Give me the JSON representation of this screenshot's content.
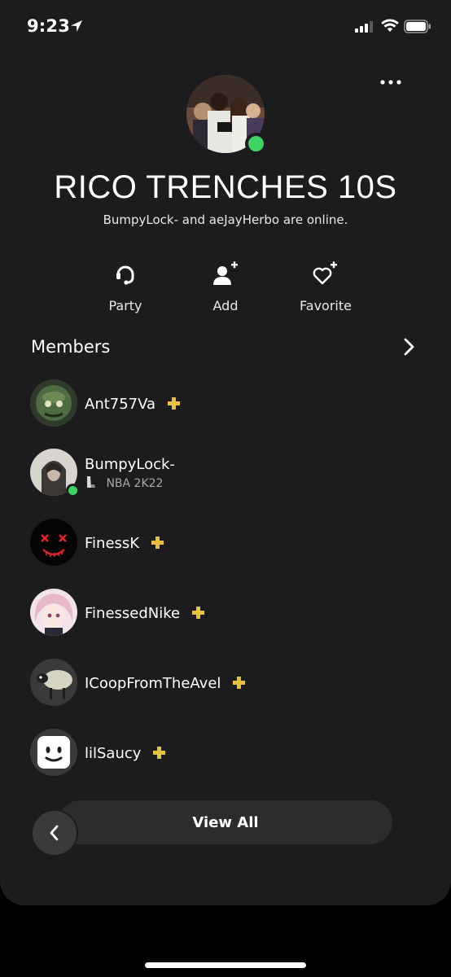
{
  "status_bar": {
    "time": "9:23"
  },
  "group": {
    "name": "RICO TRENCHES 10S",
    "online_summary": "BumpyLock- and aeJayHerbo are online."
  },
  "actions": [
    {
      "label": "Party",
      "icon": "headset-icon"
    },
    {
      "label": "Add",
      "icon": "add-user-icon"
    },
    {
      "label": "Favorite",
      "icon": "heart-plus-icon"
    }
  ],
  "members_section": {
    "title": "Members"
  },
  "members": [
    {
      "name": "Ant757Va",
      "plus": true,
      "online": false,
      "activity": ""
    },
    {
      "name": "BumpyLock-",
      "plus": false,
      "online": true,
      "activity": "NBA 2K22"
    },
    {
      "name": "FinessK",
      "plus": true,
      "online": false,
      "activity": ""
    },
    {
      "name": "FinessedNike",
      "plus": true,
      "online": false,
      "activity": ""
    },
    {
      "name": "ICoopFromTheAvel",
      "plus": true,
      "online": false,
      "activity": ""
    },
    {
      "name": "lilSaucy",
      "plus": true,
      "online": false,
      "activity": ""
    }
  ],
  "footer": {
    "view_all_label": "View All"
  },
  "colors": {
    "background": "#1c1c1e",
    "online_green": "#3ed464",
    "plus_gold": "#e8c23a",
    "button_bg": "#2c2c2e"
  }
}
